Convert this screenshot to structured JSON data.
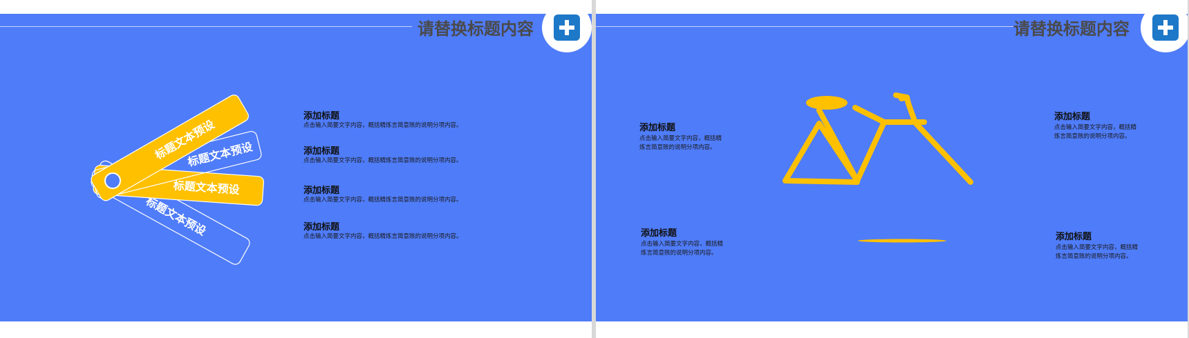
{
  "slides": [
    {
      "title": "请替换标题内容",
      "tags": [
        "标题文本预设",
        "标题文本预设",
        "标题文本预设",
        "标题文本预设"
      ],
      "items": [
        {
          "title": "添加标题",
          "desc": "点击输入简要文字内容，概括精炼言简意赅的说明分项内容。"
        },
        {
          "title": "添加标题",
          "desc": "点击输入简要文字内容，概括精炼言简意赅的说明分项内容。"
        },
        {
          "title": "添加标题",
          "desc": "点击输入简要文字内容，概括精炼言简意赅的说明分项内容。"
        },
        {
          "title": "添加标题",
          "desc": "点击输入简要文字内容，概括精炼言简意赅的说明分项内容。"
        }
      ]
    },
    {
      "title": "请替换标题内容",
      "items": [
        {
          "title": "添加标题",
          "desc": "点击输入简要文字内容，概括精炼言简意赅的说明分项内容。"
        },
        {
          "title": "添加标题",
          "desc": "点击输入简要文字内容，概括精炼言简意赅的说明分项内容。"
        },
        {
          "title": "添加标题",
          "desc": "点击输入简要文字内容，概括精炼言简意赅的说明分项内容。"
        },
        {
          "title": "添加标题",
          "desc": "点击输入简要文字内容，概括精炼言简意赅的说明分项内容。"
        }
      ]
    }
  ],
  "colors": {
    "background": "#4f7cf8",
    "accent": "#ffc000",
    "badge": "#1e78c8",
    "title": "#4a4a4a"
  },
  "icons": {
    "badge": "plus-icon",
    "illustration": "bicycle-icon"
  }
}
